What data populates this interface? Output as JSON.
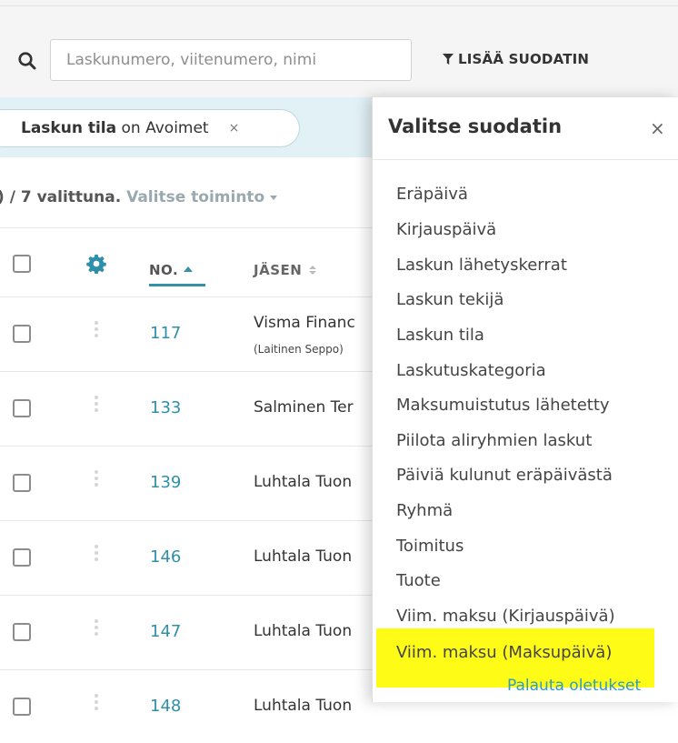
{
  "search": {
    "placeholder": "Laskunumero, viitenumero, nimi",
    "add_filter_label": "LISÄÄ SUODATIN"
  },
  "active_filter": {
    "name": "Laskun tila",
    "operator": " on ",
    "value": "Avoimet",
    "close": "×"
  },
  "selection": {
    "count_text": ") / 7 valittuna.",
    "action_label": "Valitse toiminto"
  },
  "table": {
    "headers": {
      "no": "NO.",
      "member": "JÄSEN"
    },
    "rows": [
      {
        "no": "117",
        "member": "Visma Financ",
        "sub": "(Laitinen Seppo)"
      },
      {
        "no": "133",
        "member": "Salminen Ter",
        "sub": ""
      },
      {
        "no": "139",
        "member": "Luhtala Tuon",
        "sub": ""
      },
      {
        "no": "146",
        "member": "Luhtala Tuon",
        "sub": ""
      },
      {
        "no": "147",
        "member": "Luhtala Tuon",
        "sub": ""
      },
      {
        "no": "148",
        "member": "Luhtala Tuon",
        "sub": ""
      }
    ]
  },
  "filter_panel": {
    "title": "Valitse suodatin",
    "close": "×",
    "options": [
      "Eräpäivä",
      "Kirjauspäivä",
      "Laskun lähetyskerrat",
      "Laskun tekijä",
      "Laskun tila",
      "Laskutuskategoria",
      "Maksumuistutus lähetetty",
      "Piilota aliryhmien laskut",
      "Päiviä kulunut eräpäivästä",
      "Ryhmä",
      "Toimitus",
      "Tuote",
      "Viim. maksu (Kirjauspäivä)",
      "Viim. maksu (Maksupäivä)"
    ],
    "reset_label": "Palauta oletukset"
  },
  "colors": {
    "accent": "#2f8fab",
    "filter_band": "#e2f1f6",
    "highlight": "#fefb16"
  }
}
